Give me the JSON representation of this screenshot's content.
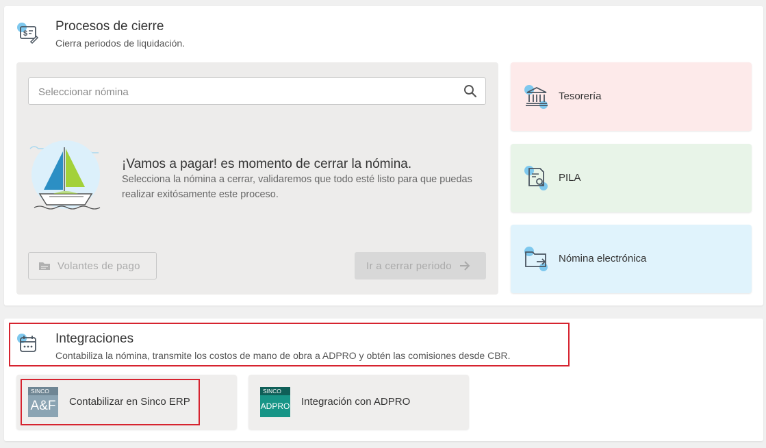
{
  "procesos": {
    "title": "Procesos de cierre",
    "subtitle": "Cierra periodos de liquidación.",
    "search": {
      "placeholder": "Seleccionar nómina",
      "value": ""
    },
    "empty_state": {
      "title": "¡Vamos a pagar! es momento de cerrar la nómina.",
      "description": "Selecciona la nómina a cerrar, validaremos que todo esté listo para que puedas realizar exitósamente este proceso."
    },
    "buttons": {
      "volantes": "Volantes de pago",
      "cerrar": "Ir a cerrar periodo"
    },
    "side_cards": [
      {
        "label": "Tesorería",
        "icon": "bank-icon"
      },
      {
        "label": "PILA",
        "icon": "document-search-icon"
      },
      {
        "label": "Nómina electrónica",
        "icon": "folder-send-icon"
      }
    ]
  },
  "integraciones": {
    "title": "Integraciones",
    "subtitle": "Contabiliza la nómina, transmite los costos de mano de obra a ADPRO y obtén las comisiones desde CBR.",
    "cards": [
      {
        "label": "Contabilizar en Sinco ERP",
        "logo_top": "SINCO",
        "logo_main": "A&F"
      },
      {
        "label": "Integración con ADPRO",
        "logo_top": "SINCO",
        "logo_main": "ADPRO"
      }
    ]
  },
  "colors": {
    "highlight": "#d6232f",
    "tesoreria_bg": "#fdeaea",
    "pila_bg": "#e8f4e8",
    "nomina_bg": "#e0f3fc",
    "icon_accent": "#7ec8ee"
  }
}
